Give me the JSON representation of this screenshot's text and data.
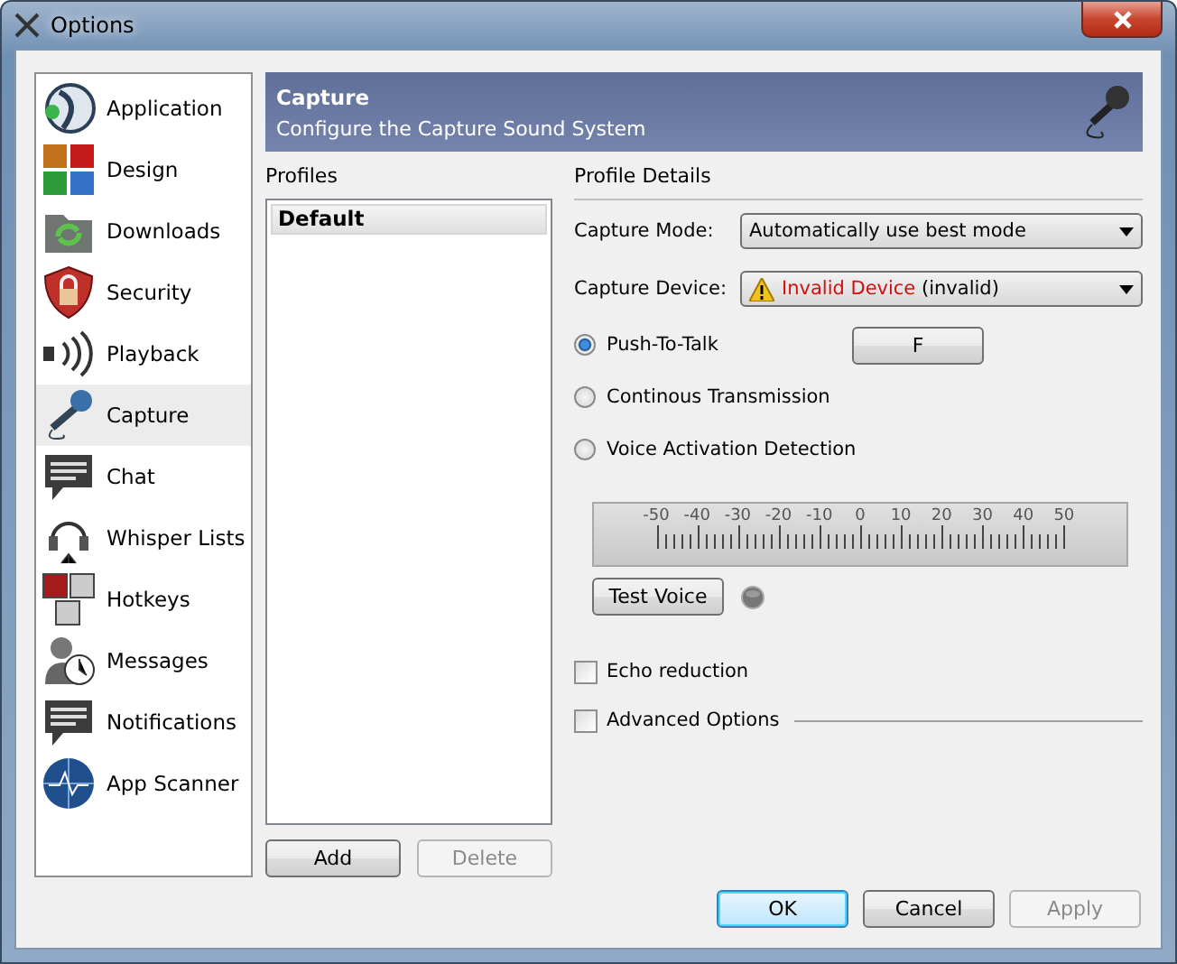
{
  "window": {
    "title": "Options"
  },
  "sidebar": {
    "items": [
      {
        "label": "Application",
        "selected": false
      },
      {
        "label": "Design",
        "selected": false
      },
      {
        "label": "Downloads",
        "selected": false
      },
      {
        "label": "Security",
        "selected": false
      },
      {
        "label": "Playback",
        "selected": false
      },
      {
        "label": "Capture",
        "selected": true
      },
      {
        "label": "Chat",
        "selected": false
      },
      {
        "label": "Whisper Lists",
        "selected": false
      },
      {
        "label": "Hotkeys",
        "selected": false
      },
      {
        "label": "Messages",
        "selected": false
      },
      {
        "label": "Notifications",
        "selected": false
      },
      {
        "label": "App Scanner",
        "selected": false
      }
    ]
  },
  "header": {
    "title": "Capture",
    "subtitle": "Configure the Capture Sound System"
  },
  "profiles": {
    "label": "Profiles",
    "items": [
      {
        "label": "Default",
        "selected": true
      }
    ],
    "buttons": [
      {
        "label": "Add",
        "disabled": false
      },
      {
        "label": "Delete",
        "disabled": true
      }
    ]
  },
  "details": {
    "label": "Profile Details",
    "capture_mode": {
      "label": "Capture Mode:",
      "value": "Automatically use best mode"
    },
    "capture_device": {
      "label": "Capture Device:",
      "error": "Invalid Device",
      "value": "(invalid)"
    },
    "modes": [
      {
        "label": "Push-To-Talk",
        "selected": true,
        "hotkey": "F"
      },
      {
        "label": "Continous Transmission",
        "selected": false
      },
      {
        "label": "Voice Activation Detection",
        "selected": false
      }
    ],
    "meter_scale": [
      "-50",
      "-40",
      "-30",
      "-20",
      "-10",
      "0",
      "10",
      "20",
      "30",
      "40",
      "50"
    ],
    "test_button": "Test Voice",
    "options": [
      {
        "label": "Echo reduction",
        "checked": false
      },
      {
        "label": "Advanced Options",
        "checked": false
      }
    ]
  },
  "buttons": [
    {
      "label": "OK",
      "default": true,
      "disabled": false
    },
    {
      "label": "Cancel",
      "default": false,
      "disabled": false
    },
    {
      "label": "Apply",
      "default": false,
      "disabled": true
    }
  ]
}
